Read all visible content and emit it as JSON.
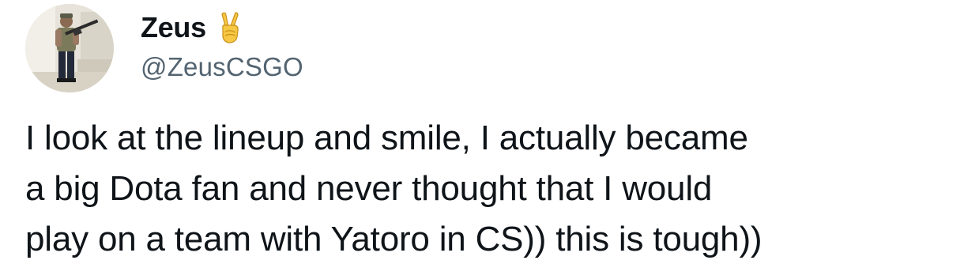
{
  "author": {
    "display_name": "Zeus",
    "handle": "@ZeusCSGO",
    "emoji_icon": "victory-hand-emoji"
  },
  "tweet": {
    "lines": [
      "I look at the lineup and smile, I actually became",
      "a big Dota fan and never thought that I would",
      "play on a team with Yatoro in CS)) this is tough))"
    ]
  },
  "colors": {
    "text": "#0f1419",
    "handle": "#536471",
    "background": "#ffffff"
  }
}
